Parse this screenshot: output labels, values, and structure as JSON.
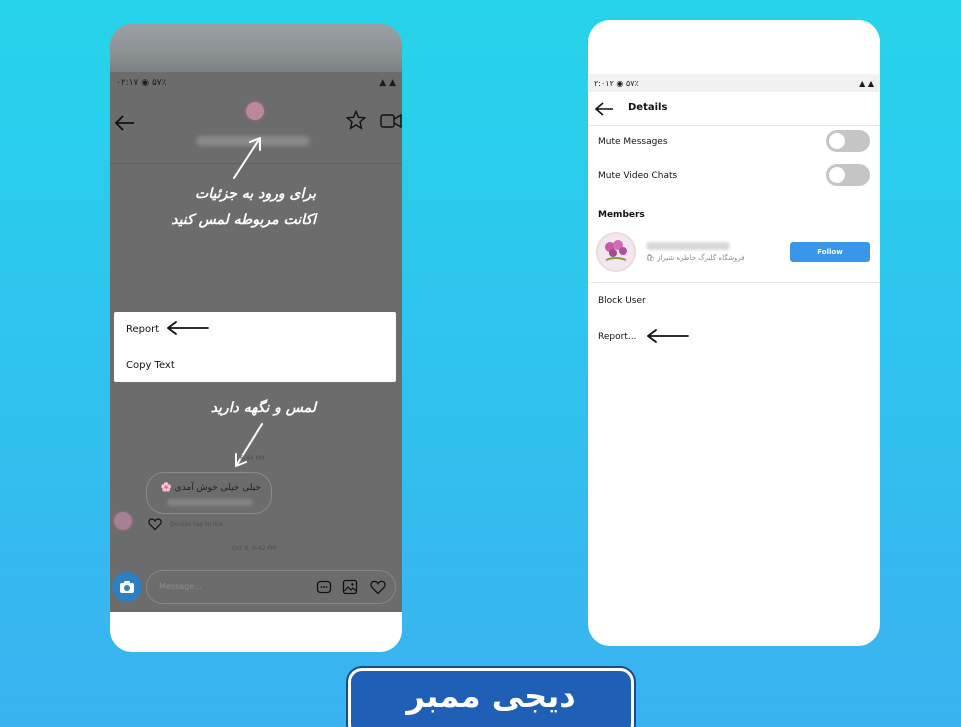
{
  "left_phone": {
    "statusbar": {
      "left": "۰۲:۱۷ ◉ ۵۷٪",
      "right": "▲ ▲"
    },
    "note_top_line1": "برای ورود به جزئیات",
    "note_top_line2": "اکانت مربوطه لمس کنید",
    "menu": {
      "items": [
        {
          "label": "Report"
        },
        {
          "label": "Copy Text"
        }
      ]
    },
    "note_bottom": "لمس و نگهه دارید",
    "chat": {
      "timestamp_top": "6:44 PM",
      "bubble_text": "خیلی خیلی خوش آمدی 🌸",
      "double_tap": "Double tap to like",
      "timestamp_bottom": "Oct 8, 9:42 PM"
    },
    "input": {
      "placeholder": "Message..."
    }
  },
  "right_phone": {
    "statusbar": {
      "left": "۲:۰۱۲ ◉ ۵۷٪",
      "right": "▲ ▲"
    },
    "header_title": "Details",
    "rows": [
      {
        "label": "Mute Messages",
        "toggle_on": false
      },
      {
        "label": "Mute Video Chats",
        "toggle_on": false
      }
    ],
    "members_title": "Members",
    "member": {
      "subtitle": "فروشگاه گلبرگ خاطره شیراز 🛍"
    },
    "follow_label": "Follow",
    "block_user": "Block User",
    "report": "Report..."
  },
  "brand": {
    "label": "دیجی ممبر"
  },
  "colors": {
    "background_top": "#26d4ea",
    "background_bottom": "#3ab2f0",
    "follow_button": "#3a96ea",
    "brand_box": "#1f5fb5",
    "overlay": "#6c6c6c"
  }
}
